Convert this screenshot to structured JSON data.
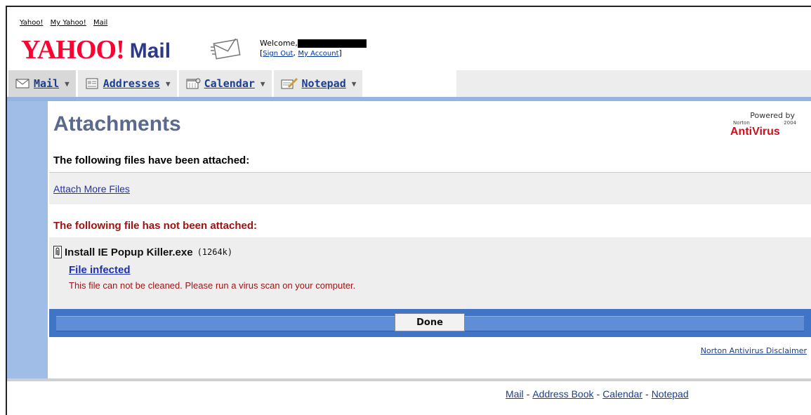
{
  "top_links": [
    "Yahoo!",
    "My Yahoo!",
    "Mail"
  ],
  "logo": {
    "yahoo": "YAHOO!",
    "mail": "Mail"
  },
  "welcome": {
    "label": "Welcome,",
    "sign_out": "Sign Out",
    "separator": ",",
    "my_account": "My Account"
  },
  "tabs": [
    {
      "label": "Mail",
      "icon": "envelope-icon"
    },
    {
      "label": "Addresses",
      "icon": "address-book-icon"
    },
    {
      "label": "Calendar",
      "icon": "calendar-icon"
    },
    {
      "label": "Notepad",
      "icon": "notepad-icon"
    }
  ],
  "page": {
    "title": "Attachments",
    "attached_heading": "The following files have been attached:",
    "attach_more": "Attach More Files",
    "not_attached_heading": "The following file has not been attached:"
  },
  "norton": {
    "powered_by": "Powered by",
    "brand_small": "Norton",
    "year": "2004",
    "product": "AntiVirus"
  },
  "file": {
    "name": "Install IE Popup Killer.exe",
    "size": "(1264k)",
    "status_link": "File infected",
    "message": "This file can not be cleaned. Please run a virus scan on your computer."
  },
  "actions": {
    "done": "Done",
    "disclaimer": "Norton Antivirus Disclaimer"
  },
  "footer": {
    "links": [
      "Mail",
      "Address Book",
      "Calendar",
      "Notepad"
    ],
    "separator": "-"
  },
  "colors": {
    "accent_blue": "#3f74c6",
    "sidebar_blue": "#a0bde8",
    "error_red": "#a01111",
    "yahoo_red": "#ff0033",
    "link_blue": "#1b3e8f"
  }
}
